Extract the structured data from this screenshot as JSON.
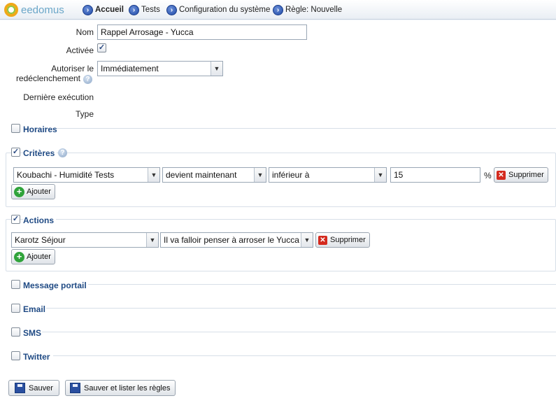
{
  "app": {
    "logo_text": "eedomus"
  },
  "nav": [
    {
      "label": "Accueil",
      "icon": "arrow-right-icon"
    },
    {
      "label": "Tests",
      "icon": "arrow-right-icon"
    },
    {
      "label": "Configuration du système",
      "icon": "arrow-right-icon"
    },
    {
      "label": "Règle: Nouvelle",
      "icon": "arrow-right-icon"
    }
  ],
  "form": {
    "name_label": "Nom",
    "name_value": "Rappel Arrosage - Yucca",
    "active_label": "Activée",
    "active_checked": true,
    "retrigger_label_1": "Autoriser le",
    "retrigger_label_2": "redéclenchement",
    "retrigger_value": "Immédiatement",
    "last_exec_label": "Dernière exécution",
    "type_label": "Type"
  },
  "sections": {
    "horaires": {
      "title": "Horaires",
      "checked": false
    },
    "criteres": {
      "title": "Critères",
      "checked": true,
      "row": {
        "device": "Koubachi - Humidité Tests",
        "condition": "devient maintenant",
        "operator": "inférieur à",
        "value": "15",
        "unit": "%",
        "delete_label": "Supprimer"
      },
      "add_label": "Ajouter"
    },
    "actions": {
      "title": "Actions",
      "checked": true,
      "row": {
        "device": "Karotz Séjour",
        "message": "Il va falloir penser à arroser le Yucca",
        "delete_label": "Supprimer"
      },
      "add_label": "Ajouter"
    },
    "message_portail": {
      "title": "Message portail",
      "checked": false
    },
    "email": {
      "title": "Email",
      "checked": false
    },
    "sms": {
      "title": "SMS",
      "checked": false
    },
    "twitter": {
      "title": "Twitter",
      "checked": false
    }
  },
  "footer": {
    "save_label": "Sauver",
    "save_list_label": "Sauver et lister les règles"
  },
  "colors": {
    "section_title": "#1f4a84",
    "delete_red": "#d42a1e",
    "add_green": "#2fa33a"
  }
}
